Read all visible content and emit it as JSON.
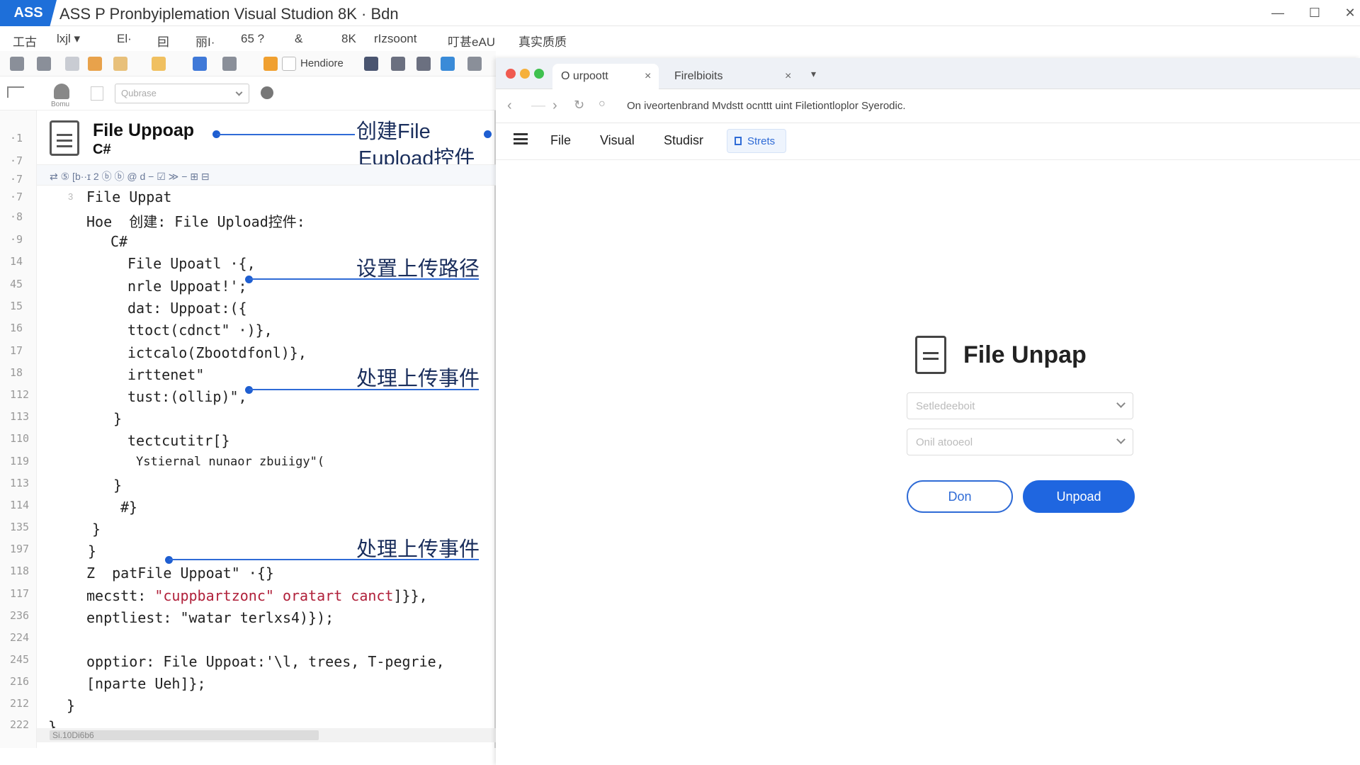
{
  "window": {
    "badge": "ASS",
    "title": "ASS P Pronbyiplemation Visual Studion  8K · Bdn",
    "minimize_glyph": "—",
    "maximize_glyph": "☐",
    "close_glyph": "✕"
  },
  "menu": [
    "工古",
    "lxjl ▾",
    "El·",
    "囙",
    "丽I·",
    "65 ?",
    "&",
    "8K",
    "rIzsoont",
    "叮甚eAU",
    "真实质质"
  ],
  "toolbar": {
    "control_label": "Hendiore",
    "search_placeholder": "Qubrase",
    "left_label": "Bomu"
  },
  "editor": {
    "header_title": "File Uppoap",
    "header_subtitle": "C#",
    "code_bar": "⇄  ⑤  [b··ɪ  2  ⓑ  ⓑ  @ d  −  ☑  ≫ −  ⊞  ⊟",
    "callouts": {
      "top_line1": "创建File",
      "top_line2": "Eupload控件",
      "path": "设置上传路径",
      "event1": "处理上传事件",
      "event2": "处理上传事件"
    },
    "line_numbers": [
      "·1",
      "·7",
      "·7",
      "·7",
      "·8",
      "·9",
      "14",
      "45",
      "15",
      "16",
      "17",
      "18",
      "112",
      "113",
      "110",
      "119",
      "113",
      "114",
      "135",
      "197",
      "118",
      "117",
      "236",
      "224",
      "245",
      "216",
      "212",
      "222"
    ],
    "lines": [
      "File Uppat",
      "Hoe  创建: File Upload控件:",
      "C#",
      "File Upoatl ·{,",
      "nrle Uppoat!';",
      "dat: Uppoat:({",
      "ttoct(cdnct\" ·)},",
      "ictcalo(Zbootdfonl)},",
      "irttenet\"",
      "tust:(ollip)\",",
      "}",
      "tectcutitr[}",
      "Ystiernal nunaor zbuiigy\"(",
      "}",
      "#}",
      "}",
      "}",
      "Z  patFile Uppoat\" ·{}",
      "mecstt: \"cuppbartzonc\" oratart canct]}},",
      "enptliest: \"watar terlxs4)});",
      "opptior: File Uppoat:'\\l, trees, T-pegrie,",
      "[nparte Ueh]};",
      "}",
      "}"
    ],
    "red_segment": "\"cuppbartzonc\" oratart canct",
    "scroll_label": "Si.10Di6b6"
  },
  "browser": {
    "tabs": [
      {
        "label": "O urpoott",
        "close": "×"
      },
      {
        "label": "Firelbioits",
        "close": "×"
      }
    ],
    "tab_dropdown": "▾",
    "url": "On iveortenbrand Mvdstt ocnttt uint Filetiontloplor Syerodic.",
    "nav": [
      "File",
      "Visual",
      "Studisr"
    ],
    "nav_active": "Strets",
    "page": {
      "title": "File Unpap",
      "select1_placeholder": "Setledeeboit",
      "select2_placeholder": "Onil atooeol",
      "cancel_label": "Don",
      "upload_label": "Unpoad"
    }
  },
  "colors": {
    "accent": "#1f66e0",
    "callout_line": "#2f6bd6",
    "callout_text": "#1a2e5c",
    "code_red": "#b0203a"
  }
}
